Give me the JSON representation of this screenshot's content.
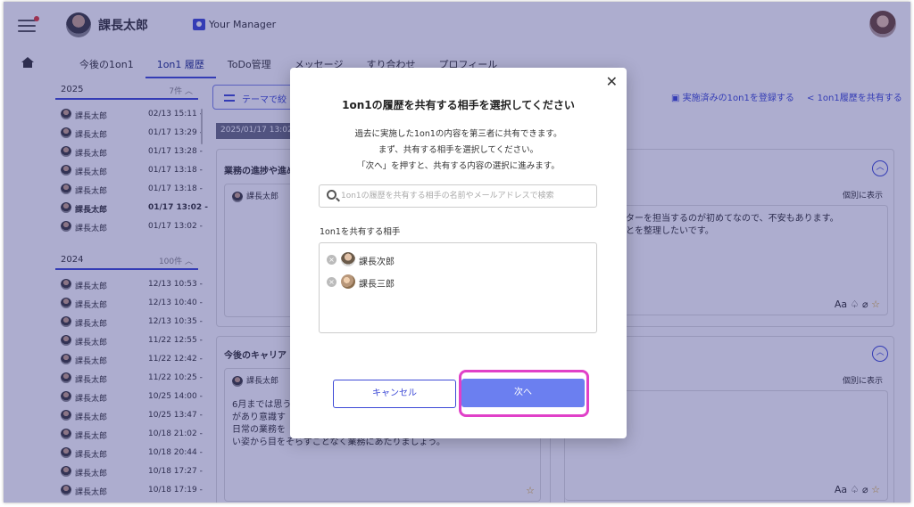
{
  "header": {
    "user_name": "課長太郎",
    "manager_label": "Your Manager"
  },
  "tabs": [
    "今後の1on1",
    "1on1 履歴",
    "ToDo管理",
    "メッセージ",
    "すり合わせ",
    "プロフィール"
  ],
  "history": {
    "year_2025": {
      "year": "2025",
      "count": "7件",
      "rows": [
        {
          "name": "課長太郎",
          "date": "02/13 15:11 -"
        },
        {
          "name": "課長太郎",
          "date": "01/17 13:29 -"
        },
        {
          "name": "課長太郎",
          "date": "01/17 13:28 -"
        },
        {
          "name": "課長太郎",
          "date": "01/17 13:18 -"
        },
        {
          "name": "課長太郎",
          "date": "01/17 13:18 -"
        },
        {
          "name": "課長太郎",
          "date": "01/17 13:02 -"
        },
        {
          "name": "課長太郎",
          "date": "01/17 13:02 -"
        }
      ]
    },
    "year_2024": {
      "year": "2024",
      "count": "100件",
      "rows": [
        {
          "name": "課長太郎",
          "date": "12/13 10:53 -"
        },
        {
          "name": "課長太郎",
          "date": "12/13 10:40 -"
        },
        {
          "name": "課長太郎",
          "date": "12/13 10:35 -"
        },
        {
          "name": "課長太郎",
          "date": "11/22 12:55 -"
        },
        {
          "name": "課長太郎",
          "date": "11/22 12:42 -"
        },
        {
          "name": "課長太郎",
          "date": "11/22 10:25 -"
        },
        {
          "name": "課長太郎",
          "date": "10/25 14:00 -"
        },
        {
          "name": "課長太郎",
          "date": "10/25 13:47 -"
        },
        {
          "name": "課長太郎",
          "date": "10/18 21:02 -"
        },
        {
          "name": "課長太郎",
          "date": "10/18 20:44 -"
        },
        {
          "name": "課長太郎",
          "date": "10/18 17:27 -"
        },
        {
          "name": "課長太郎",
          "date": "10/18 17:19 -"
        }
      ]
    }
  },
  "main": {
    "filter_label": "テーマで絞",
    "date_pill": "2025/01/17 13:02",
    "link_register": "実施済みの1on1を登録する",
    "link_share": "1on1履歴を共有する",
    "card1_title": "業務の進捗や進め",
    "card1_author": "課長太郎",
    "card1_right_text_1": "ンターを担当するのが初めてなので、不安もあります。",
    "card1_right_text_2": "ことを整理したいです。",
    "indiv_label": "個別に表示",
    "card2_title": "今後のキャリア",
    "card2_author": "課長太郎",
    "card2_text_1": "6月までは思う",
    "card2_text_2": "があり意識す",
    "card2_text_3": "日常の業務を",
    "card2_text_4": "い姿から目をそらすことなく業務にあたりましょう。",
    "tool_aa": "Aa"
  },
  "modal": {
    "title": "1on1の履歴を共有する相手を選択してください",
    "desc_1": "過去に実施した1on1の内容を第三者に共有できます。",
    "desc_2": "まず、共有する相手を選択してください。",
    "desc_3": "「次へ」を押すと、共有する内容の選択に進みます。",
    "search_placeholder": "1on1の履歴を共有する相手の名前やメールアドレスで検索",
    "share_label": "1on1を共有する相手",
    "selected": [
      {
        "name": "課長次郎"
      },
      {
        "name": "課長三郎"
      }
    ],
    "cancel_label": "キャンセル",
    "next_label": "次へ"
  }
}
